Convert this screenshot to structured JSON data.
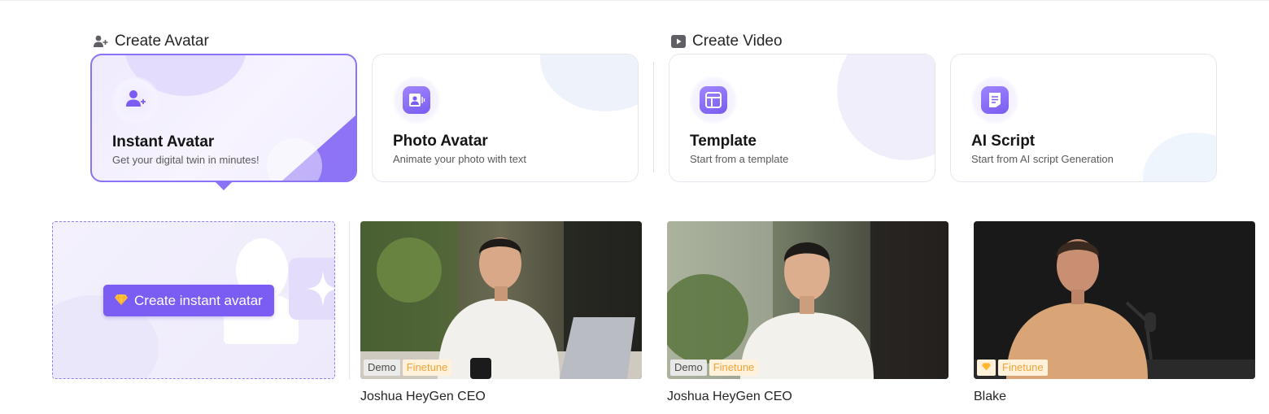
{
  "create_avatar": {
    "title": "Create Avatar",
    "cards": [
      {
        "title": "Instant Avatar",
        "subtitle": "Get your digital twin in minutes!",
        "icon": "user-plus-icon",
        "active": true
      },
      {
        "title": "Photo Avatar",
        "subtitle": "Animate your photo with text",
        "icon": "photo-avatar-icon",
        "active": false
      }
    ]
  },
  "create_video": {
    "title": "Create Video",
    "cards": [
      {
        "title": "Template",
        "subtitle": "Start from a template",
        "icon": "template-icon"
      },
      {
        "title": "AI Script",
        "subtitle": "Start from AI script Generation",
        "icon": "script-icon"
      }
    ]
  },
  "create_instant": {
    "label": "Create instant avatar",
    "icon": "gem-icon"
  },
  "avatars": [
    {
      "name": "Joshua HeyGen CEO",
      "tags": [
        "Demo",
        "Finetune"
      ]
    },
    {
      "name": "Joshua HeyGen CEO",
      "tags": [
        "Demo",
        "Finetune"
      ]
    },
    {
      "name": "Blake",
      "tags": [
        "Finetune"
      ],
      "badge_icon": "gem-icon"
    }
  ],
  "colors": {
    "accent": "#7b5df4",
    "accent_border": "#8b73f7",
    "finetune_text": "#f0a43b",
    "finetune_bg": "#fff1da"
  }
}
